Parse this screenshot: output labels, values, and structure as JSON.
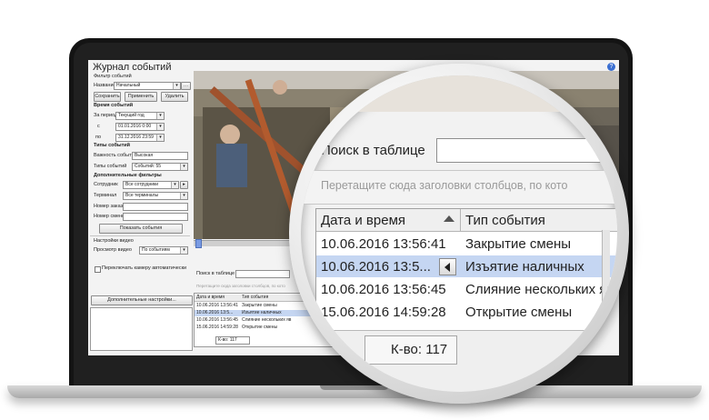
{
  "app": {
    "title": "Журнал событий",
    "help": "?"
  },
  "filter": {
    "section_title": "Фильтр событий",
    "name_label": "Название",
    "name_value": "Начальный",
    "save_label": "Сохранить",
    "apply_label": "Применить",
    "delete_label": "Удалить"
  },
  "time": {
    "section_title": "Время событий",
    "period_label": "За период",
    "period_value": "Текущий год",
    "from_label": "с",
    "from_value": "01.01.2016 0:00",
    "to_label": "по",
    "to_value": "31.12.2016 23:59"
  },
  "types": {
    "section_title": "Типы событий",
    "importance_label": "Важность события",
    "importance_value": "Высокая",
    "types_label": "Типы событий",
    "types_value": "Событий: 55"
  },
  "extra": {
    "section_title": "Дополнительные фильтры",
    "employee_label": "Сотрудник",
    "employee_value": "Все сотрудники",
    "terminal_label": "Терминал",
    "terminal_value": "Все терминалы",
    "order_label": "Номер заказа",
    "shift_label": "Номер смены",
    "show_events_label": "Показать события"
  },
  "video": {
    "section_title": "Настройки видео",
    "view_label": "Просмотр видео",
    "view_value": "По событиям",
    "auto_switch_label": "Переключать камеру автоматически",
    "more_settings_label": "Дополнительные настройки..."
  },
  "table": {
    "search_label": "Поиск в таблице",
    "group_hint": "Перетащите сюда заголовки столбцов, по кото",
    "columns": [
      "Дата и время",
      "Тип события"
    ],
    "rows": [
      [
        "10.06.2016 13:56:41",
        "Закрытие смены"
      ],
      [
        "10.06.2016 13:5...",
        "Изъятие наличных"
      ],
      [
        "10.06.2016 13:56:45",
        "Слияние нескольких яв"
      ],
      [
        "15.06.2016 14:59:28",
        "Открытие смены"
      ]
    ],
    "count_label": "К-во: 117",
    "selected_row": 1
  },
  "colors": {
    "selection": "#c5d6f2",
    "accent": "#3b6fd1"
  }
}
